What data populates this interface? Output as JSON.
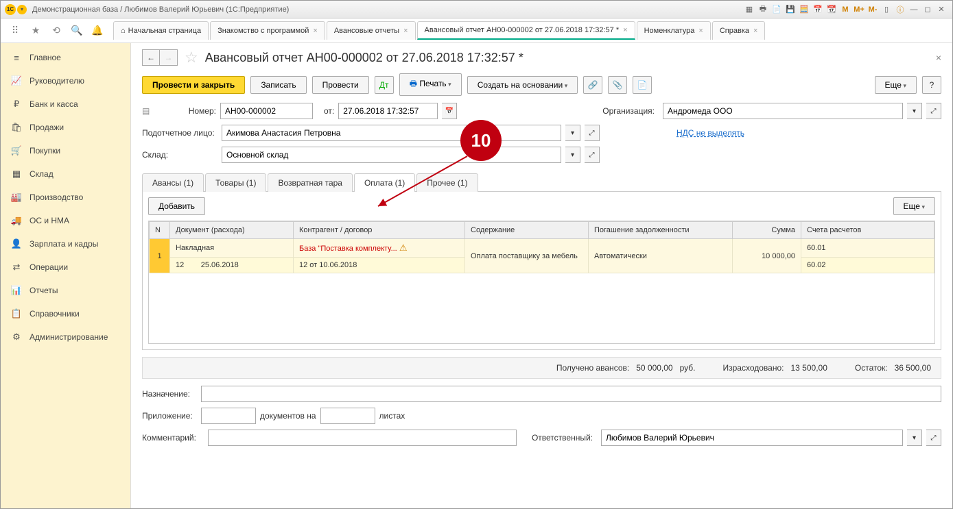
{
  "window_title": "Демонстрационная база / Любимов Валерий Юрьевич  (1С:Предприятие)",
  "tabs": [
    {
      "label": "Начальная страница",
      "home": true
    },
    {
      "label": "Знакомство с программой"
    },
    {
      "label": "Авансовые отчеты"
    },
    {
      "label": "Авансовый отчет АН00-000002 от 27.06.2018 17:32:57 *",
      "active": true
    },
    {
      "label": "Номенклатура"
    },
    {
      "label": "Справка"
    }
  ],
  "sidebar": [
    {
      "icon": "≡",
      "label": "Главное"
    },
    {
      "icon": "📈",
      "label": "Руководителю"
    },
    {
      "icon": "₽",
      "label": "Банк и касса"
    },
    {
      "icon": "🛍",
      "label": "Продажи"
    },
    {
      "icon": "🛒",
      "label": "Покупки"
    },
    {
      "icon": "▦",
      "label": "Склад"
    },
    {
      "icon": "🏭",
      "label": "Производство"
    },
    {
      "icon": "🚚",
      "label": "ОС и НМА"
    },
    {
      "icon": "👤",
      "label": "Зарплата и кадры"
    },
    {
      "icon": "⇄",
      "label": "Операции"
    },
    {
      "icon": "📊",
      "label": "Отчеты"
    },
    {
      "icon": "📋",
      "label": "Справочники"
    },
    {
      "icon": "⚙",
      "label": "Администрирование"
    }
  ],
  "page": {
    "title": "Авансовый отчет АН00-000002 от 27.06.2018 17:32:57 *",
    "buttons": {
      "post_close": "Провести и закрыть",
      "save": "Записать",
      "post": "Провести",
      "print": "Печать",
      "create_based": "Создать на основании",
      "more": "Еще",
      "add": "Добавить"
    },
    "fields": {
      "number_label": "Номер:",
      "number": "АН00-000002",
      "from_label": "от:",
      "date": "27.06.2018 17:32:57",
      "org_label": "Организация:",
      "org": "Андромеда ООО",
      "person_label": "Подотчетное лицо:",
      "person": "Акимова Анастасия Петровна",
      "vat_link": "НДС не выделять",
      "warehouse_label": "Склад:",
      "warehouse": "Основной склад"
    },
    "dtabs": [
      "Авансы (1)",
      "Товары (1)",
      "Возвратная тара",
      "Оплата (1)",
      "Прочее (1)"
    ],
    "dtab_active": 3,
    "columns": [
      "N",
      "Документ (расхода)",
      "Контрагент / договор",
      "Содержание",
      "Погашение задолженности",
      "Сумма",
      "Счета расчетов"
    ],
    "row": {
      "n": "1",
      "doc1": "Накладная",
      "doc2": "12",
      "doc_date": "25.06.2018",
      "contragent1": "База \"Поставка комплекту...",
      "contragent2": "12 от 10.06.2018",
      "content": "Оплата поставщику за мебель",
      "debt": "Автоматически",
      "sum": "10 000,00",
      "acc1": "60.01",
      "acc2": "60.02"
    },
    "summary": {
      "advance_label": "Получено авансов:",
      "advance": "50 000,00",
      "advance_cur": "руб.",
      "spent_label": "Израсходовано:",
      "spent": "13 500,00",
      "rest_label": "Остаток:",
      "rest": "36 500,00"
    },
    "footer": {
      "purpose_label": "Назначение:",
      "attach_label": "Приложение:",
      "docs_on": "документов на",
      "sheets": "листах",
      "comment_label": "Комментарий:",
      "resp_label": "Ответственный:",
      "resp": "Любимов Валерий Юрьевич"
    }
  },
  "callout": "10"
}
